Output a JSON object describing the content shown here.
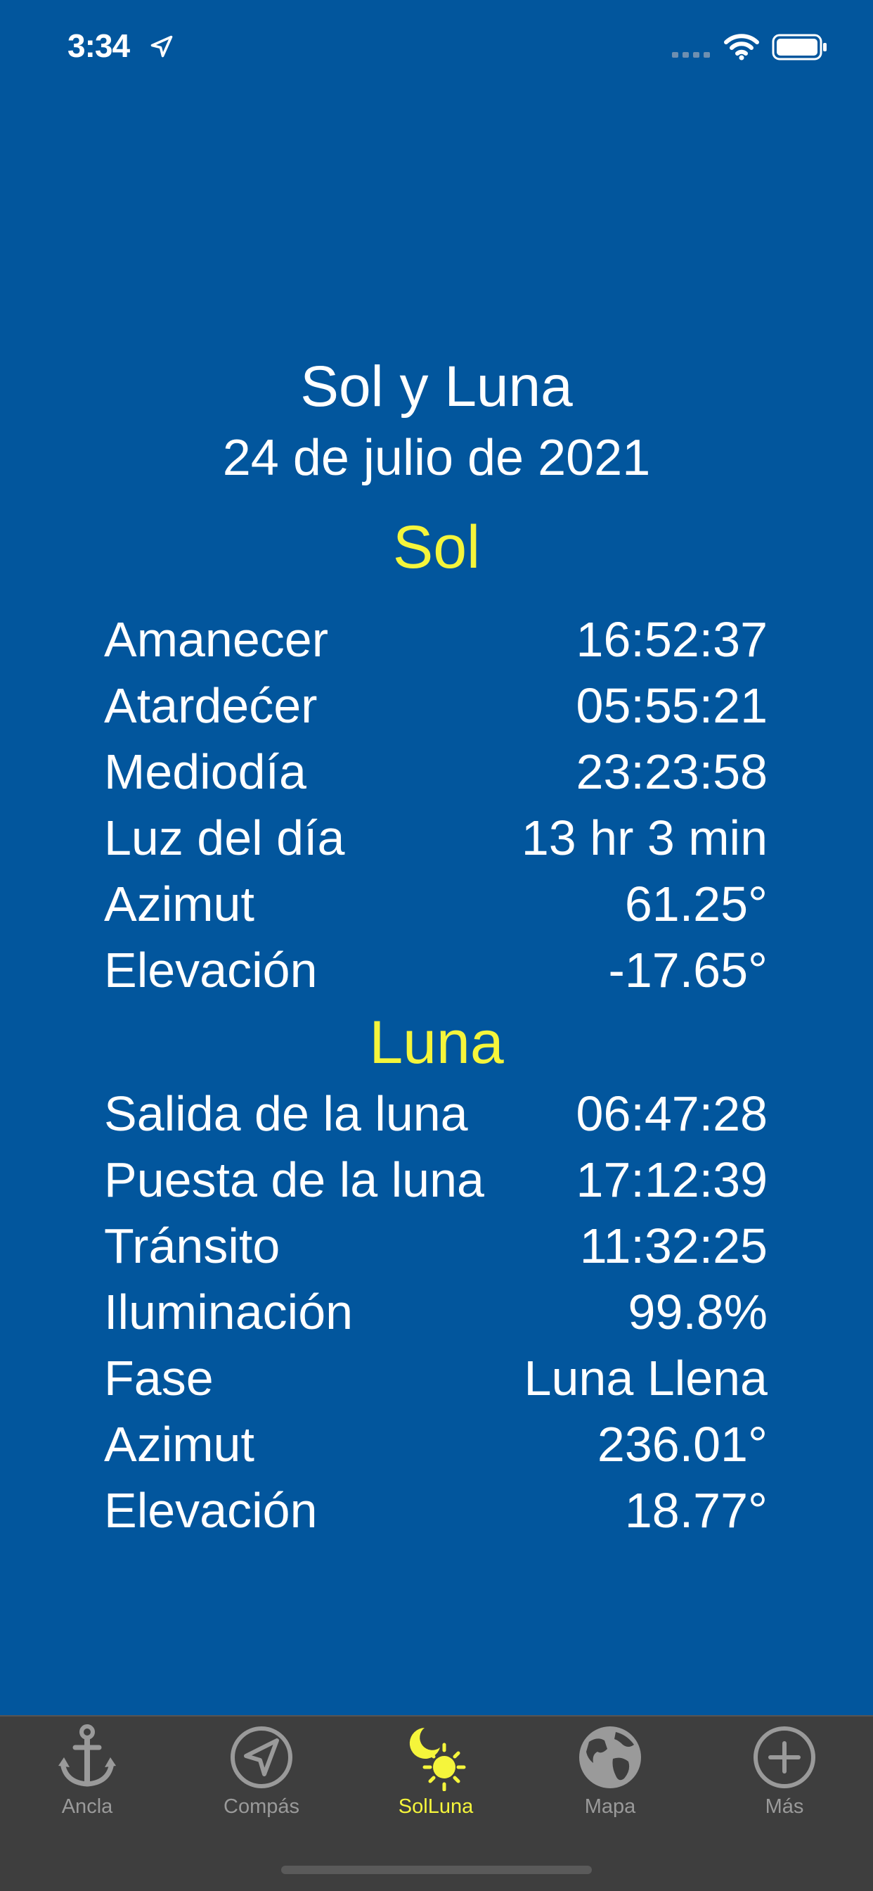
{
  "status": {
    "time": "3:34"
  },
  "header": {
    "title": "Sol y Luna",
    "date": "24 de julio de 2021"
  },
  "sol": {
    "heading": "Sol",
    "rows": [
      {
        "label": "Amanecer",
        "value": "16:52:37"
      },
      {
        "label": "Atardećer",
        "value": "05:55:21"
      },
      {
        "label": "Mediodía",
        "value": "23:23:58"
      },
      {
        "label": "Luz del día",
        "value": "13 hr 3 min"
      },
      {
        "label": "Azimut",
        "value": "61.25°"
      },
      {
        "label": "Elevación",
        "value": "-17.65°"
      }
    ]
  },
  "luna": {
    "heading": "Luna",
    "rows": [
      {
        "label": "Salida de la luna",
        "value": "06:47:28"
      },
      {
        "label": "Puesta de la luna",
        "value": "17:12:39"
      },
      {
        "label": "Tránsito",
        "value": "11:32:25"
      },
      {
        "label": "Iluminación",
        "value": "99.8%"
      },
      {
        "label": "Fase",
        "value": "Luna Llena"
      },
      {
        "label": "Azimut",
        "value": "236.01°"
      },
      {
        "label": "Elevación",
        "value": "18.77°"
      }
    ]
  },
  "tabs": [
    {
      "label": "Ancla",
      "icon": "anchor-icon"
    },
    {
      "label": "Compás",
      "icon": "compass-icon"
    },
    {
      "label": "SolLuna",
      "icon": "sun-moon-icon",
      "active": true
    },
    {
      "label": "Mapa",
      "icon": "globe-icon"
    },
    {
      "label": "Más",
      "icon": "plus-circle-icon"
    }
  ],
  "colors": {
    "background": "#02569d",
    "accent": "#f5f53b",
    "tabbar": "#3e3e3e",
    "inactive": "#9a9a9a"
  }
}
